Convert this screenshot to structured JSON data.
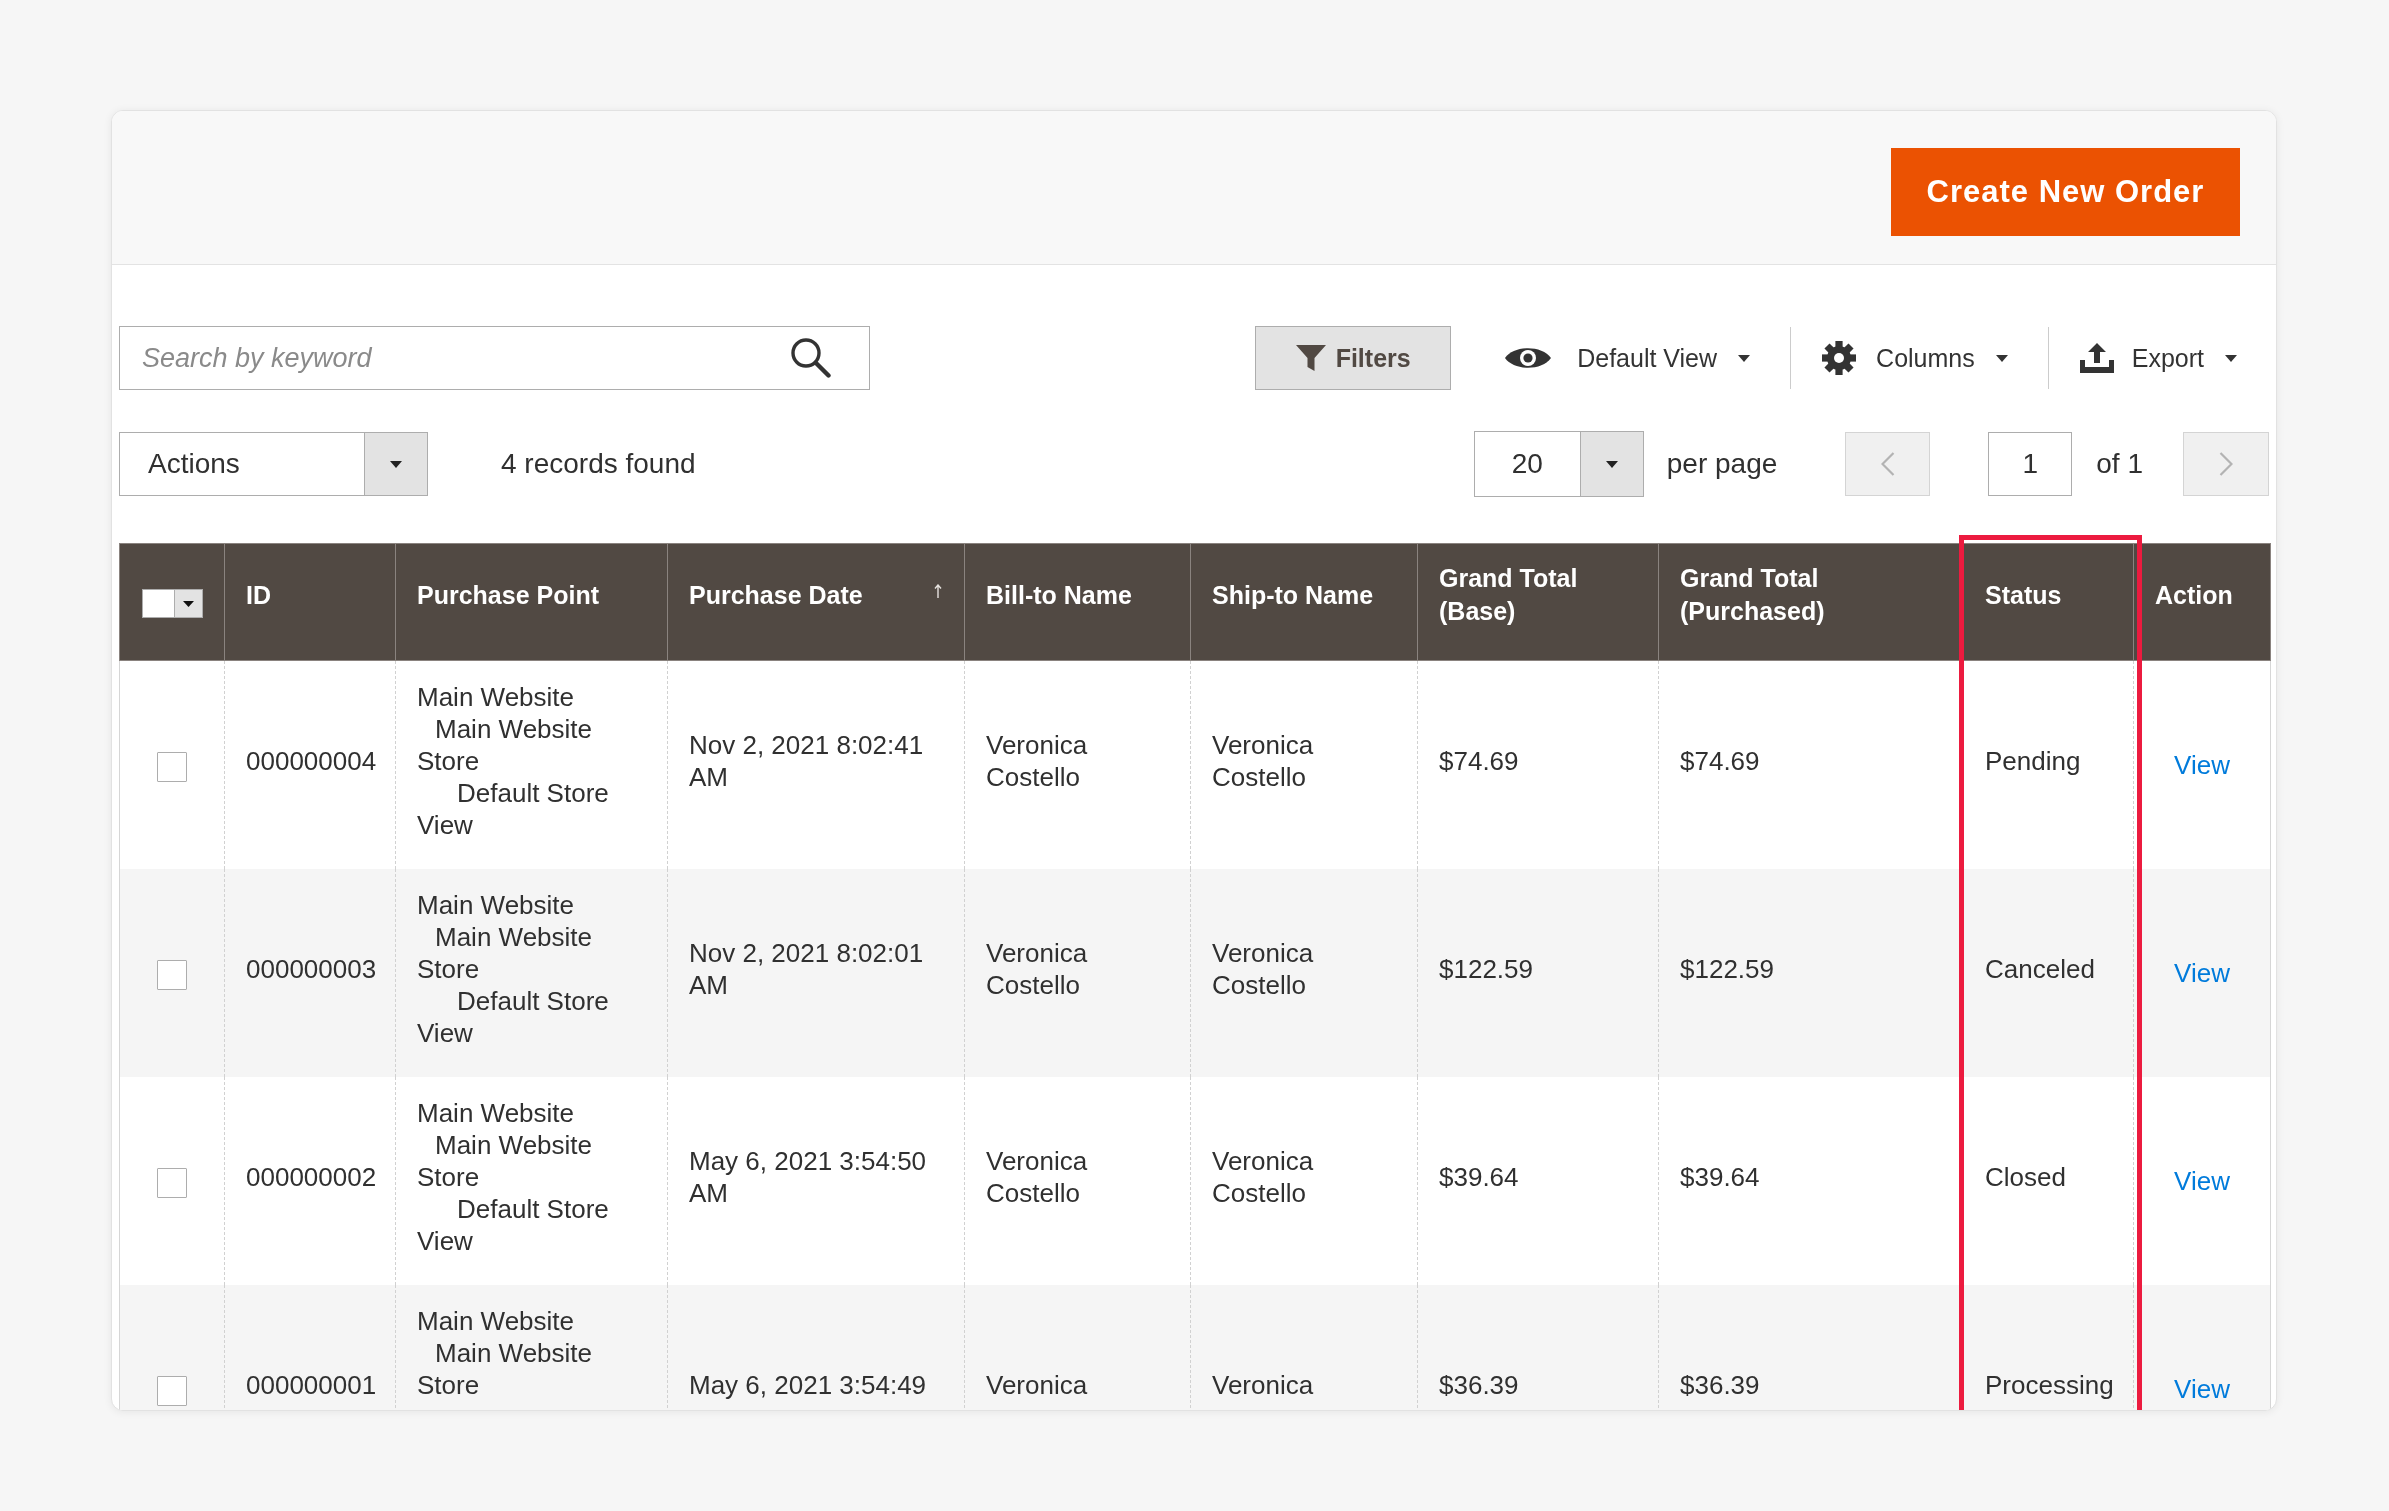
{
  "header": {
    "create_button": "Create New Order"
  },
  "toolbar": {
    "search": {
      "placeholder": "Search by keyword"
    },
    "filters": "Filters",
    "view": "Default View",
    "columns": "Columns",
    "export": "Export"
  },
  "controls": {
    "actions": "Actions",
    "records": "4 records found",
    "per_page": {
      "value": "20",
      "label": "per page"
    },
    "pager": {
      "previous": {
        "disabled": true
      },
      "page": "1",
      "total": "of 1",
      "next": {
        "disabled": true
      }
    }
  },
  "table": {
    "select_all": {
      "checked": false
    },
    "columns": [
      {
        "label": "ID",
        "sorted": false,
        "highlighted": false
      },
      {
        "label": "Purchase Point",
        "sorted": false,
        "highlighted": false
      },
      {
        "label": "Purchase Date",
        "sorted": true,
        "highlighted": false
      },
      {
        "label": "Bill-to Name",
        "sorted": false,
        "highlighted": false
      },
      {
        "label": "Ship-to Name",
        "sorted": false,
        "highlighted": false
      },
      {
        "label": "Grand Total (Base)",
        "sorted": false,
        "highlighted": false
      },
      {
        "label": "Grand Total (Purchased)",
        "sorted": false,
        "highlighted": false
      },
      {
        "label": "Status",
        "sorted": false,
        "highlighted": true
      },
      {
        "label": "Action",
        "sorted": false,
        "highlighted": false
      }
    ],
    "rows": [
      {
        "checked": false,
        "id": "000000004",
        "purchase_point": {
          "website": "Main Website",
          "store": "Main Website Store",
          "store_view": "Default Store View"
        },
        "purchase_date": "Nov 2, 2021 8:02:41 AM",
        "bill_to": "Veronica Costello",
        "ship_to": "Veronica Costello",
        "total_base": "$74.69",
        "total_purchased": "$74.69",
        "status": "Pending",
        "action": "View"
      },
      {
        "checked": false,
        "id": "000000003",
        "purchase_point": {
          "website": "Main Website",
          "store": "Main Website Store",
          "store_view": "Default Store View"
        },
        "purchase_date": "Nov 2, 2021 8:02:01 AM",
        "bill_to": "Veronica Costello",
        "ship_to": "Veronica Costello",
        "total_base": "$122.59",
        "total_purchased": "$122.59",
        "status": "Canceled",
        "action": "View"
      },
      {
        "checked": false,
        "id": "000000002",
        "purchase_point": {
          "website": "Main Website",
          "store": "Main Website Store",
          "store_view": "Default Store View"
        },
        "purchase_date": "May 6, 2021 3:54:50 AM",
        "bill_to": "Veronica Costello",
        "ship_to": "Veronica Costello",
        "total_base": "$39.64",
        "total_purchased": "$39.64",
        "status": "Closed",
        "action": "View"
      },
      {
        "checked": false,
        "id": "000000001",
        "purchase_point": {
          "website": "Main Website",
          "store": "Main Website Store"
        },
        "purchase_date": "May 6, 2021 3:54:49",
        "bill_to": "Veronica",
        "ship_to": "Veronica",
        "total_base": "$36.39",
        "total_purchased": "$36.39",
        "status": "Processing",
        "action": "View"
      }
    ]
  }
}
